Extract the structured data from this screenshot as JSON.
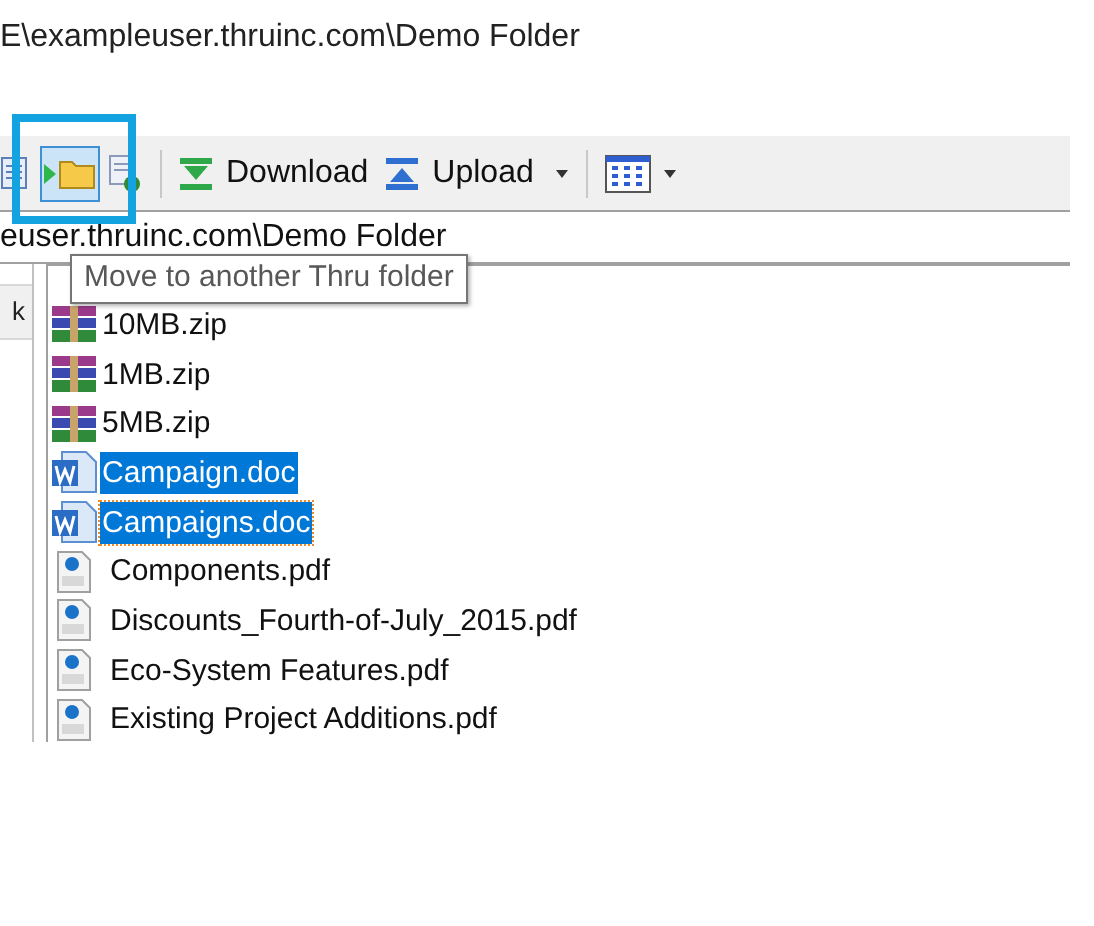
{
  "path_title": "E\\exampleuser.thruinc.com\\Demo Folder",
  "toolbar": {
    "icon_buttons": [
      {
        "kind": "copy",
        "selected": false
      },
      {
        "kind": "move",
        "selected": true
      },
      {
        "kind": "copy-remote",
        "selected": false
      }
    ],
    "download": "Download",
    "upload": "Upload"
  },
  "address": "euser.thruinc.com\\Demo Folder",
  "tooltip": "Move to another Thru folder",
  "left_pane": {
    "text": "k"
  },
  "files": [
    {
      "name": "10MB.zip",
      "kind": "zip",
      "selected": false,
      "focused": false
    },
    {
      "name": "1MB.zip",
      "kind": "zip",
      "selected": false,
      "focused": false
    },
    {
      "name": "5MB.zip",
      "kind": "zip",
      "selected": false,
      "focused": false
    },
    {
      "name": "Campaign.doc",
      "kind": "doc",
      "selected": true,
      "focused": false
    },
    {
      "name": "Campaigns.doc",
      "kind": "doc",
      "selected": true,
      "focused": true
    },
    {
      "name": "Components.pdf",
      "kind": "pdf",
      "selected": false,
      "focused": false
    },
    {
      "name": "Discounts_Fourth-of-July_2015.pdf",
      "kind": "pdf",
      "selected": false,
      "focused": false
    },
    {
      "name": "Eco-System Features.pdf",
      "kind": "pdf",
      "selected": false,
      "focused": false
    },
    {
      "name": "Existing Project Additions.pdf",
      "kind": "pdf",
      "selected": false,
      "focused": false
    }
  ]
}
